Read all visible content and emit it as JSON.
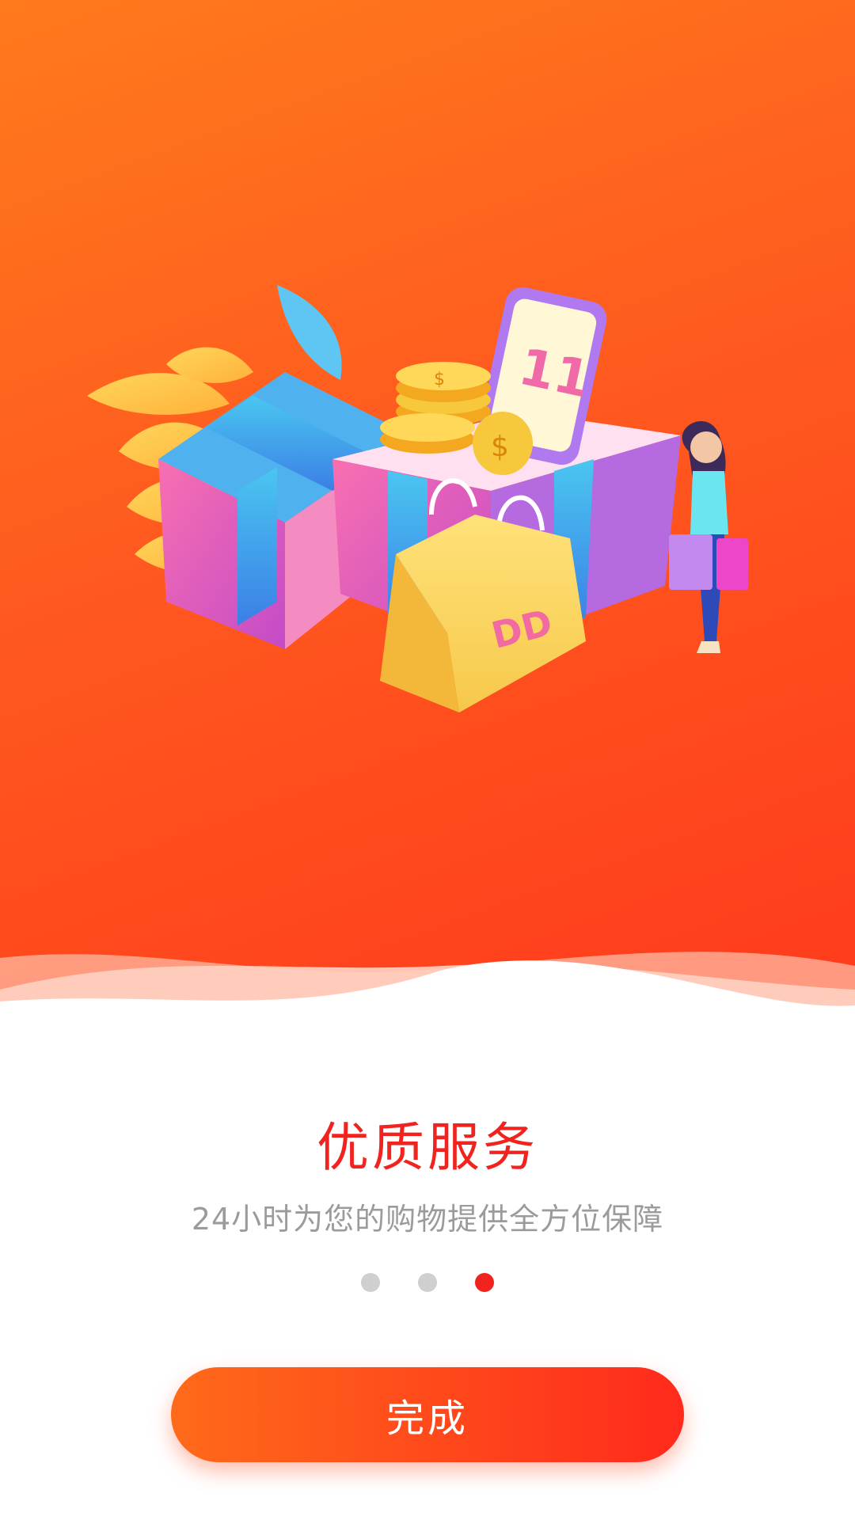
{
  "onboarding": {
    "title": "优质服务",
    "subtitle": "24小时为您的购物提供全方位保障",
    "page_indicator": {
      "total": 3,
      "current": 3
    },
    "done_button_label": "完成"
  },
  "illustration": {
    "gift_box_label": "11",
    "shopping_bag_label": "DD"
  },
  "colors": {
    "hero_gradient_start": "#ff7a1c",
    "hero_gradient_end": "#ff3a1c",
    "accent_red": "#f1231e",
    "subtitle_gray": "#9b9b9b",
    "inactive_dot": "#cfcfcf"
  }
}
